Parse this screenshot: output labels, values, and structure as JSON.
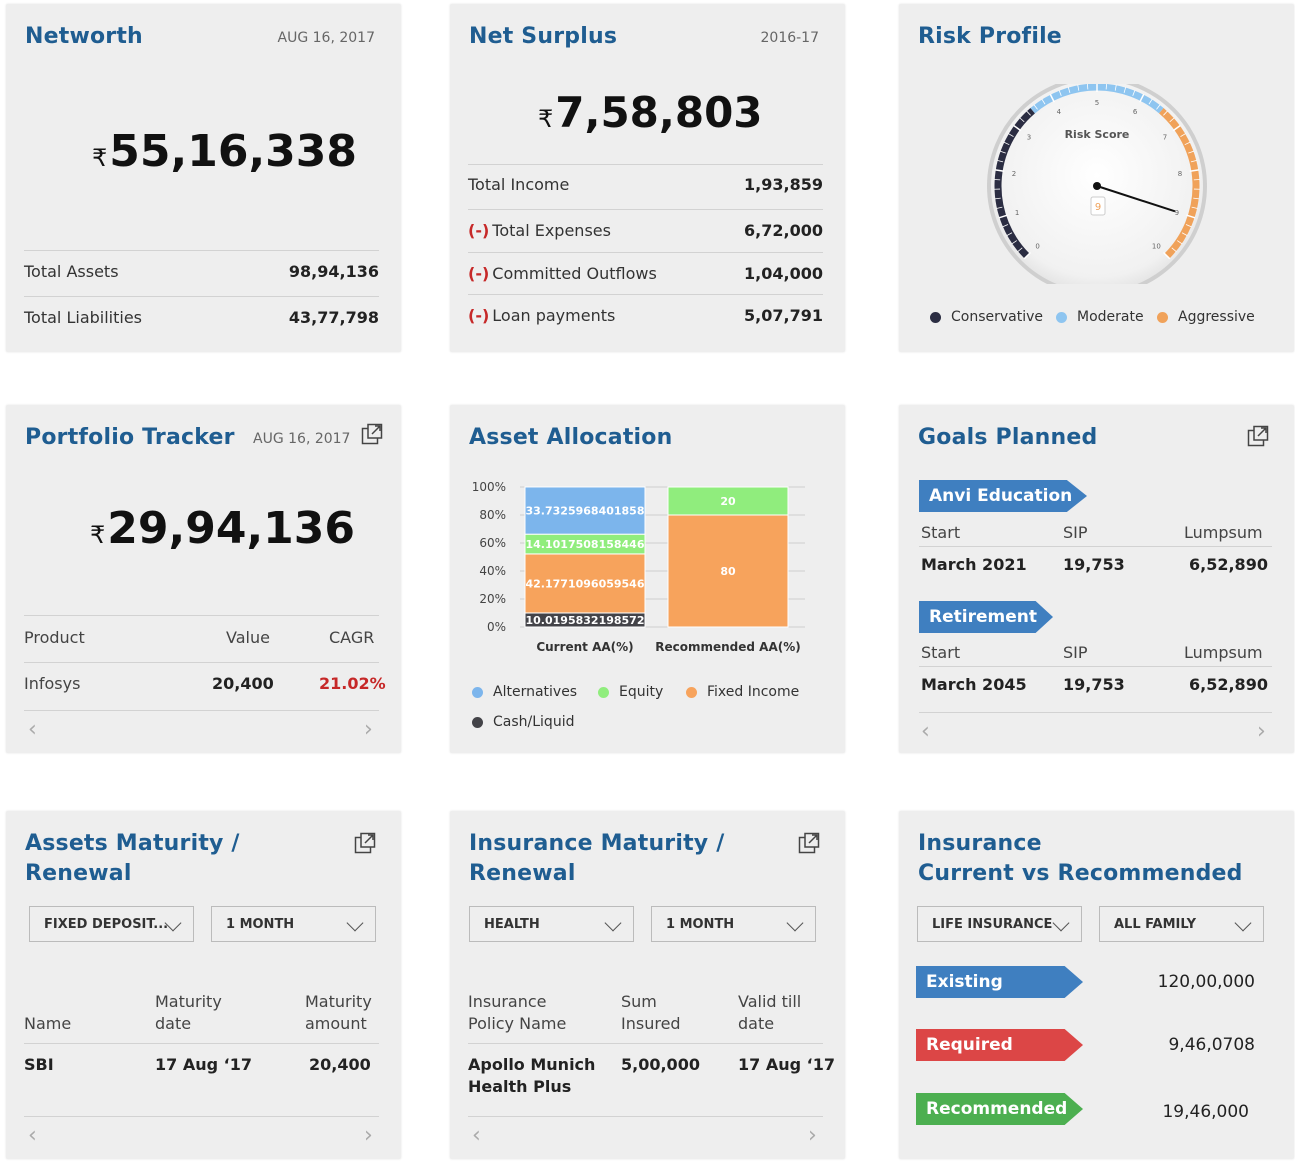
{
  "networth": {
    "title": "Networth",
    "date": "AUG 16, 2017",
    "currency": "₹",
    "amount": "55,16,338",
    "rows": [
      {
        "label": "Total Assets",
        "value": "98,94,136"
      },
      {
        "label": "Total Liabilities",
        "value": "43,77,798"
      }
    ]
  },
  "surplus": {
    "title": "Net Surplus",
    "date": "2016-17",
    "currency": "₹",
    "amount": "7,58,803",
    "income_label": "Total Income",
    "income_value": "1,93,859",
    "neg_symbol": "(-)",
    "rows": [
      {
        "label": "Total Expenses",
        "value": "6,72,000"
      },
      {
        "label": "Committed Outflows",
        "value": "1,04,000"
      },
      {
        "label": "Loan payments",
        "value": "5,07,791"
      }
    ]
  },
  "risk": {
    "title": "Risk Profile",
    "gauge_label": "Risk Score",
    "score": 9,
    "score_text": "9",
    "ticks": [
      "0",
      "1",
      "2",
      "3",
      "4",
      "5",
      "6",
      "7",
      "8",
      "9",
      "10"
    ],
    "legend": [
      {
        "label": "Conservative",
        "color": "#2b2d42"
      },
      {
        "label": "Moderate",
        "color": "#8ec5f0"
      },
      {
        "label": "Aggressive",
        "color": "#f0a25a"
      }
    ]
  },
  "portfolio": {
    "title": "Portfolio Tracker",
    "date": "AUG 16, 2017",
    "currency": "₹",
    "amount": "29,94,136",
    "headers": {
      "product": "Product",
      "value": "Value",
      "cagr": "CAGR"
    },
    "row": {
      "product": "Infosys",
      "value": "20,400",
      "cagr": "21.02%"
    },
    "cagr_color": "#c62828"
  },
  "allocation": {
    "title": "Asset Allocation",
    "legend": [
      {
        "label": "Alternatives",
        "color": "#7cb5ec"
      },
      {
        "label": "Equity",
        "color": "#90ed7d"
      },
      {
        "label": "Fixed Income",
        "color": "#f7a35c"
      },
      {
        "label": "Cash/Liquid",
        "color": "#434348"
      }
    ]
  },
  "chart_data": {
    "type": "bar",
    "stacked": true,
    "categories": [
      "Current AA(%)",
      "Recommended AA(%)"
    ],
    "series": [
      {
        "name": "Cash/Liquid",
        "values": [
          10.0195832198572,
          0
        ],
        "labels": [
          "10.0195832198572",
          ""
        ]
      },
      {
        "name": "Fixed Income",
        "values": [
          42.1771096059546,
          80
        ],
        "labels": [
          "42.1771096059546",
          "80"
        ]
      },
      {
        "name": "Equity",
        "values": [
          14.1017508158446,
          20
        ],
        "labels": [
          "14.1017508158446",
          "20"
        ]
      },
      {
        "name": "Alternatives",
        "values": [
          33.7325968401858,
          0
        ],
        "labels": [
          "33.7325968401858",
          ""
        ]
      }
    ],
    "ylim": [
      0,
      100
    ],
    "yticks": [
      "0%",
      "20%",
      "40%",
      "60%",
      "80%",
      "100%"
    ],
    "legend_position": "bottom",
    "grid": true
  },
  "goals": {
    "title": "Goals Planned",
    "headers": {
      "start": "Start",
      "sip": "SIP",
      "lumpsum": "Lumpsum"
    },
    "items": [
      {
        "name": "Anvi Education",
        "start": "March 2021",
        "sip": "19,753",
        "lumpsum": "6,52,890"
      },
      {
        "name": "Retirement",
        "start": "March 2045",
        "sip": "19,753",
        "lumpsum": "6,52,890"
      }
    ]
  },
  "assets_maturity": {
    "title_line1": "Assets Maturity /",
    "title_line2": "Renewal",
    "select1": "FIXED DEPOSIT...",
    "select2": "1 MONTH",
    "headers": {
      "name": "Name",
      "maturity_date": "Maturity\ndate",
      "maturity_amount": "Maturity\namount"
    },
    "row": {
      "name": "SBI",
      "date": "17 Aug ‘17",
      "amount": "20,400"
    }
  },
  "insurance_maturity": {
    "title_line1": "Insurance Maturity /",
    "title_line2": "Renewal",
    "select1": "HEALTH",
    "select2": "1 MONTH",
    "headers": {
      "policy": "Insurance\nPolicy Name",
      "sum": "Sum\nInsured",
      "valid": "Valid till\ndate"
    },
    "row": {
      "policy": "Apollo Munich\nHealth Plus",
      "sum": "5,00,000",
      "valid": "17 Aug ‘17"
    }
  },
  "insurance_compare": {
    "title_line1": "Insurance",
    "title_line2": "Current vs Recommended",
    "select1": "LIFE INSURANCE",
    "select2": "ALL FAMILY",
    "items": [
      {
        "label": "Existing",
        "value": "120,00,000",
        "color": "#3f7fc0"
      },
      {
        "label": "Required",
        "value": "9,46,0708",
        "color": "#dc4646"
      },
      {
        "label": "Recommended",
        "value": "19,46,000",
        "color": "#4caf50"
      }
    ]
  },
  "nav": {
    "prev": "‹",
    "next": "›"
  }
}
